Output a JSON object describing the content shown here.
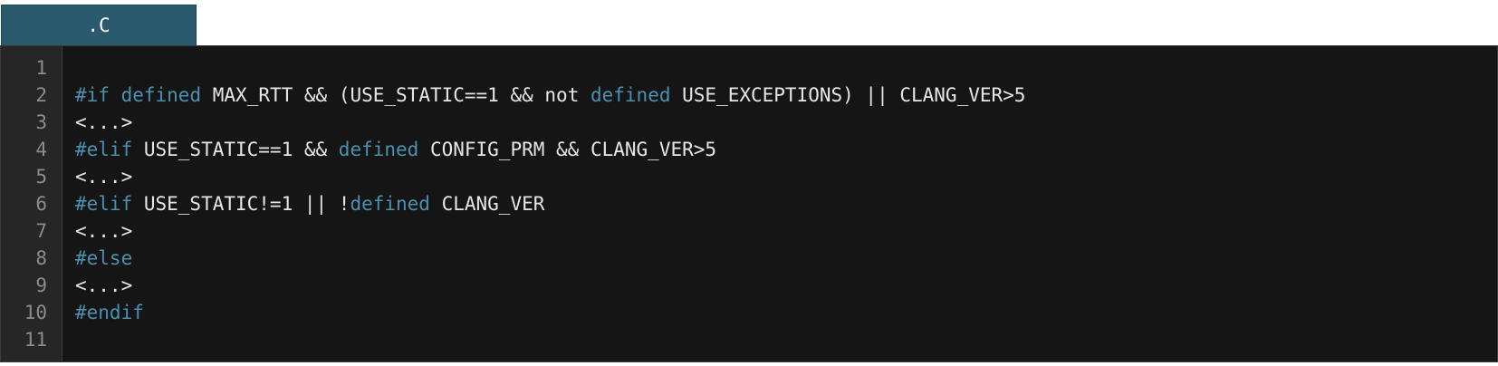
{
  "tab": {
    "label": ".C"
  },
  "colors": {
    "tab_background": "#2b5a6e",
    "editor_background": "#151515",
    "gutter_background": "#262626",
    "keyword": "#4a90b0",
    "text": "#e6e6e6",
    "line_number": "#8c8c8c"
  },
  "lines": [
    {
      "number": "1",
      "tokens": []
    },
    {
      "number": "2",
      "tokens": [
        {
          "t": "#if",
          "k": "kw"
        },
        {
          "t": " ",
          "k": "tx"
        },
        {
          "t": "defined",
          "k": "kw"
        },
        {
          "t": " MAX_RTT && (USE_STATIC==1 && not ",
          "k": "tx"
        },
        {
          "t": "defined",
          "k": "kw"
        },
        {
          "t": " USE_EXCEPTIONS) || CLANG_VER>5",
          "k": "tx"
        }
      ]
    },
    {
      "number": "3",
      "tokens": [
        {
          "t": "<...>",
          "k": "tx"
        }
      ]
    },
    {
      "number": "4",
      "tokens": [
        {
          "t": "#elif",
          "k": "kw"
        },
        {
          "t": " USE_STATIC==1 && ",
          "k": "tx"
        },
        {
          "t": "defined",
          "k": "kw"
        },
        {
          "t": " CONFIG_PRM && CLANG_VER>5",
          "k": "tx"
        }
      ]
    },
    {
      "number": "5",
      "tokens": [
        {
          "t": "<...>",
          "k": "tx"
        }
      ]
    },
    {
      "number": "6",
      "tokens": [
        {
          "t": "#elif",
          "k": "kw"
        },
        {
          "t": " USE_STATIC!=1 || !",
          "k": "tx"
        },
        {
          "t": "defined",
          "k": "kw"
        },
        {
          "t": " CLANG_VER",
          "k": "tx"
        }
      ]
    },
    {
      "number": "7",
      "tokens": [
        {
          "t": "<...>",
          "k": "tx"
        }
      ]
    },
    {
      "number": "8",
      "tokens": [
        {
          "t": "#else",
          "k": "kw"
        }
      ]
    },
    {
      "number": "9",
      "tokens": [
        {
          "t": "<...>",
          "k": "tx"
        }
      ]
    },
    {
      "number": "10",
      "tokens": [
        {
          "t": "#endif",
          "k": "kw"
        }
      ]
    },
    {
      "number": "11",
      "tokens": []
    }
  ]
}
